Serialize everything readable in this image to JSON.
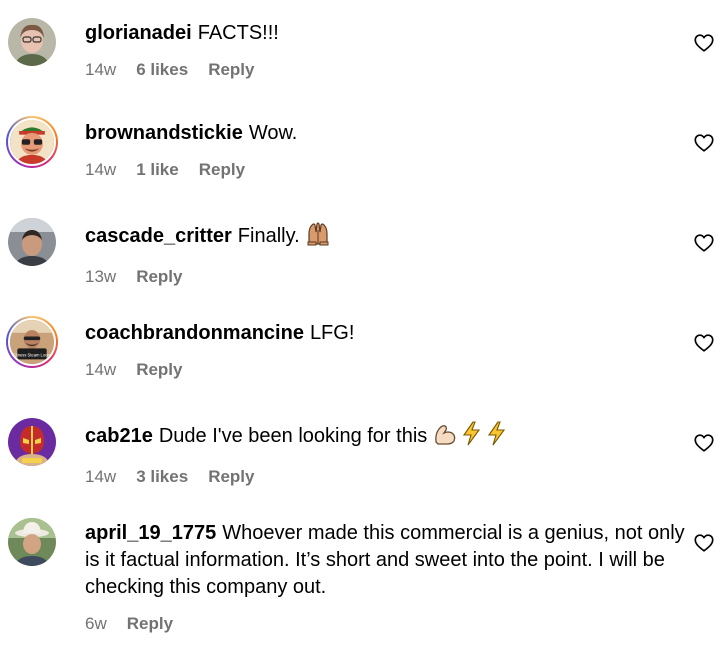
{
  "comments": [
    {
      "username": "glorianadei",
      "text": "FACTS!!!",
      "time": "14w",
      "likes": "6 likes",
      "reply": "Reply",
      "avatar": "woman-glasses-avatar"
    },
    {
      "username": "brownandstickie",
      "text": "Wow.",
      "time": "14w",
      "likes": "1 like",
      "reply": "Reply",
      "avatar": "cartoon-man-sunglasses-avatar"
    },
    {
      "username": "cascade_critter",
      "text": "Finally.",
      "time": "13w",
      "likes": "",
      "reply": "Reply",
      "avatar": "man-photo-avatar",
      "emoji": "raised-hands-emoji"
    },
    {
      "username": "coachbrandonmancine",
      "text": "LFG!",
      "time": "14w",
      "likes": "",
      "reply": "Reply",
      "avatar": "coach-fitness-avatar",
      "avatar_caption": "Fitness Steam Loom"
    },
    {
      "username": "cab21e",
      "text": "Dude I've been looking for this",
      "time": "14w",
      "likes": "3 likes",
      "reply": "Reply",
      "avatar": "wrestler-mask-avatar",
      "emoji": "flexed-biceps-lightning-emoji"
    },
    {
      "username": "april_19_1775",
      "text": "Whoever made this commercial is a genius, not only is it factual information. It’s short and sweet into the point. I will be checking this company out.",
      "time": "6w",
      "likes": "",
      "reply": "Reply",
      "avatar": "cowboy-hat-avatar"
    }
  ],
  "icons": {
    "like": "heart-outline-icon"
  },
  "colors": {
    "meta_text": "#737373",
    "story_ring_start": "#fdc468",
    "story_ring_mid": "#d62976",
    "story_ring_end": "#4f5bd5"
  }
}
